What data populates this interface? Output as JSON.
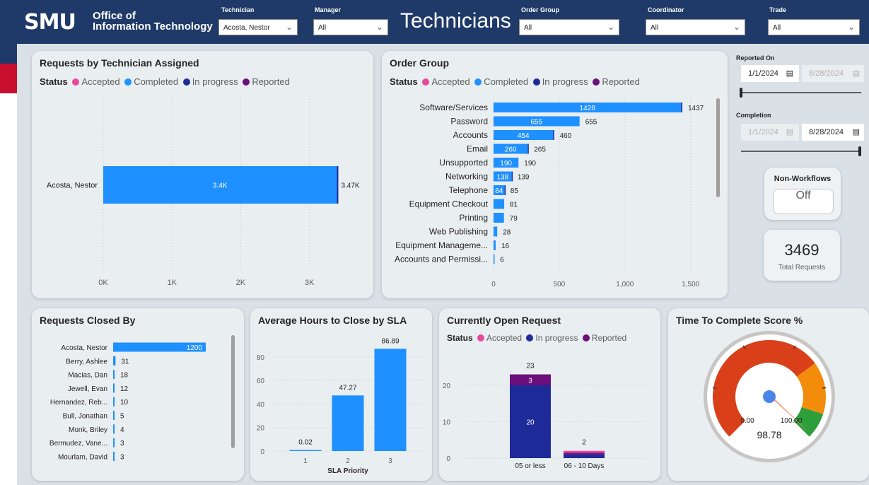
{
  "header": {
    "logo_smu": "SMU",
    "logo_line1": "Office of",
    "logo_line2": "Information Technology",
    "page_title": "Technicians",
    "slicers": [
      {
        "label": "Technician",
        "value": "Acosta, Nestor"
      },
      {
        "label": "Manager",
        "value": "All"
      },
      {
        "label": "Order Group",
        "value": "All"
      },
      {
        "label": "Coordinator",
        "value": "All"
      },
      {
        "label": "Trade",
        "value": "All"
      }
    ]
  },
  "status_legend": {
    "status_label": "Status",
    "accepted": "Accepted",
    "completed": "Completed",
    "in_progress": "In progress",
    "reported": "Reported"
  },
  "colors": {
    "accepted": "#e8479e",
    "completed": "#1e90ff",
    "in_progress": "#1f2a99",
    "reported": "#6b0f7a",
    "header": "#1f3a68",
    "accent_red": "#c8102e"
  },
  "side_panel": {
    "reported_on_label": "Reported On",
    "reported_from": "1/1/2024",
    "reported_to": "8/28/2024",
    "completion_label": "Completion",
    "completion_from": "1/1/2024",
    "completion_to": "8/28/2024",
    "non_workflows_label": "Non-Workflows",
    "non_workflows_value": "Off",
    "total_requests_value": "3469",
    "total_requests_label": "Total Requests"
  },
  "chart_data": [
    {
      "id": "requests-by-technician",
      "type": "bar",
      "title": "Requests by Technician Assigned",
      "categories": [
        "Acosta, Nestor"
      ],
      "values": [
        3400
      ],
      "value_labels": [
        "3.4K"
      ],
      "totals": [
        "3.47K"
      ],
      "xticks": [
        "0K",
        "1K",
        "2K",
        "3K"
      ],
      "xlim": [
        0,
        3700
      ]
    },
    {
      "id": "order-group",
      "type": "bar",
      "title": "Order Group",
      "categories": [
        "Software/Services",
        "Password",
        "Accounts",
        "Email",
        "Unsupported",
        "Networking",
        "Telephone",
        "Equipment Checkout",
        "Printing",
        "Web Publishing",
        "Equipment Manageme...",
        "Accounts and Permissi..."
      ],
      "values": [
        1428,
        655,
        454,
        260,
        190,
        138,
        84,
        81,
        79,
        28,
        16,
        6
      ],
      "inner_labels": [
        "1428",
        "655",
        "454",
        "260",
        "190",
        "138",
        "84",
        "",
        "",
        "",
        "",
        ""
      ],
      "totals": [
        1437,
        655,
        460,
        265,
        190,
        139,
        85,
        81,
        79,
        28,
        16,
        6
      ],
      "xticks": [
        "0",
        "500",
        "1,000",
        "1,500"
      ],
      "xlim": [
        0,
        1580
      ]
    },
    {
      "id": "requests-closed-by",
      "type": "bar",
      "title": "Requests Closed By",
      "categories": [
        "Acosta, Nestor",
        "Berry, Ashlee",
        "Macias, Dan",
        "Jewell, Evan",
        "Hernandez, Reb...",
        "Bull, Jonathan",
        "Monk, Briley",
        "Bermudez, Vane...",
        "Mourlam, David"
      ],
      "values": [
        1200,
        31,
        18,
        12,
        10,
        5,
        4,
        3,
        3
      ],
      "xlim": [
        0,
        1200
      ]
    },
    {
      "id": "avg-hours-to-close",
      "type": "bar",
      "title": "Average Hours to Close by SLA",
      "categories": [
        "1",
        "2",
        "3"
      ],
      "values": [
        0.02,
        47.27,
        86.89
      ],
      "value_labels": [
        "0.02",
        "47.27",
        "86.89"
      ],
      "xlabel": "SLA Priority",
      "yticks": [
        "0",
        "20",
        "40",
        "60",
        "80"
      ],
      "ylim": [
        0,
        95
      ]
    },
    {
      "id": "currently-open",
      "type": "bar",
      "title": "Currently Open Request",
      "categories": [
        "05 or less",
        "06 - 10 Days"
      ],
      "series": [
        {
          "name": "In progress",
          "values": [
            20,
            1
          ]
        },
        {
          "name": "Reported",
          "values": [
            3,
            0.5
          ]
        },
        {
          "name": "Accepted",
          "values": [
            0,
            0.5
          ]
        }
      ],
      "segment_labels": [
        [
          "20",
          "3"
        ],
        [
          "",
          ""
        ]
      ],
      "totals": [
        "23",
        "2"
      ],
      "yticks": [
        "0",
        "10",
        "20"
      ],
      "ylim": [
        0,
        26
      ]
    },
    {
      "id": "time-to-complete",
      "type": "gauge",
      "title": "Time To Complete Score %",
      "value": 98.78,
      "value_label": "98.78",
      "min_label": "0.00",
      "max_label": "100.00",
      "range": [
        0,
        100
      ],
      "bands": [
        {
          "to": 70,
          "color": "#d9401a"
        },
        {
          "to": 90,
          "color": "#f28c0a"
        },
        {
          "to": 100,
          "color": "#2e9e3a"
        }
      ]
    }
  ]
}
